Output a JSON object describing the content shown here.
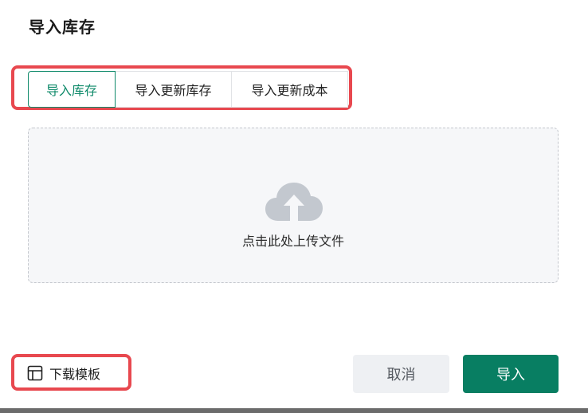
{
  "dialog": {
    "title": "导入库存"
  },
  "tabs": [
    {
      "label": "导入库存",
      "active": true
    },
    {
      "label": "导入更新库存",
      "active": false
    },
    {
      "label": "导入更新成本",
      "active": false
    }
  ],
  "upload": {
    "text": "点击此处上传文件",
    "icon": "cloud-upload-icon"
  },
  "footer": {
    "download_template": "下载模板",
    "download_icon": "template-icon",
    "cancel": "取消",
    "import": "导入"
  },
  "colors": {
    "primary": "#087e62",
    "tab_active_text": "#0f8a6a",
    "highlight": "#e8484f",
    "upload_bg": "#f6f7f9"
  }
}
